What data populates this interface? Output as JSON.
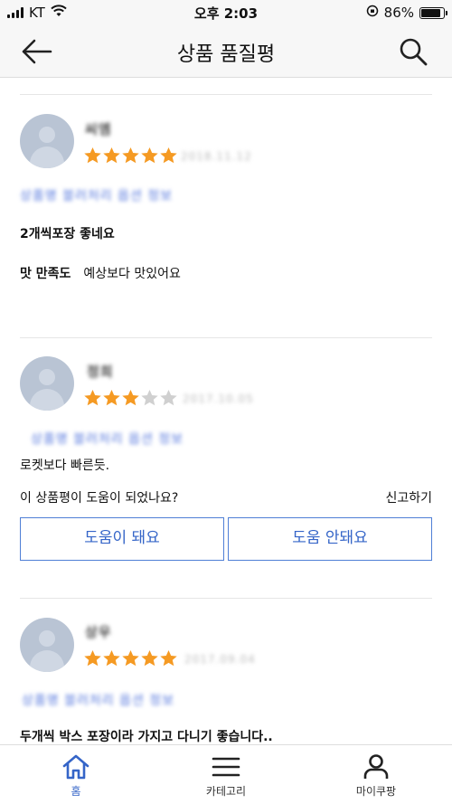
{
  "status_bar": {
    "carrier": "KT",
    "time": "오후 2:03",
    "battery_percent": "86%",
    "battery_level": 0.86
  },
  "header": {
    "title": "상품 품질평",
    "back_icon": "arrow-left-icon",
    "search_icon": "search-icon"
  },
  "reviews": [
    {
      "author": "씨엠",
      "rating": 5,
      "date": "2018.11.12",
      "product": "상품명 블러처리 옵션 정보",
      "headline": "2개씩포장 좋네요",
      "detail_key": "맛 만족도",
      "detail_value": "예상보다 맛있어요"
    },
    {
      "author": "정희",
      "rating": 3,
      "date": "2017.10.05",
      "product": "상품명 블러처리 옵션 정보",
      "body": "로켓보다  빠른듯.",
      "helpful_question": "이 상품평이 도움이 되었나요?",
      "report_label": "신고하기",
      "helpful_yes": "도움이 돼요",
      "helpful_no": "도움 안돼요"
    },
    {
      "author": "상우",
      "rating": 5,
      "date": "2017.09.04",
      "product": "상품명 블러처리 옵션 정보",
      "headline": "두개씩 박스 포장이라 가지고 다니기 좋습니다.."
    }
  ],
  "bottom_nav": {
    "items": [
      {
        "label": "홈",
        "icon": "home-icon",
        "active": true
      },
      {
        "label": "카테고리",
        "icon": "menu-icon",
        "active": false
      },
      {
        "label": "마이쿠팡",
        "icon": "person-icon",
        "active": false
      }
    ]
  },
  "colors": {
    "star": "#f59a23",
    "star_off": "#d0d0d0",
    "accent": "#3565c8"
  }
}
